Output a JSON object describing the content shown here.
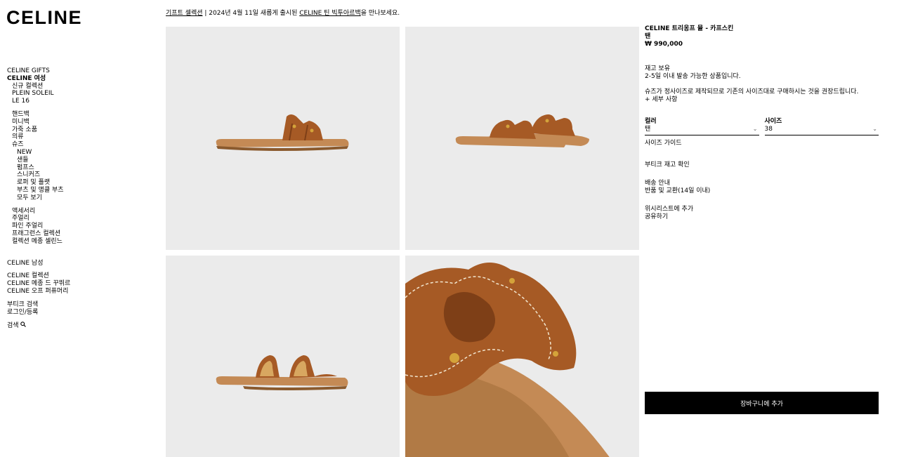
{
  "brand": "CELINE",
  "promo": {
    "link1": "기프트 셀렉션",
    "sep": " | 2024년 4월 11일 새롭게 출시된 ",
    "link2": "CELINE 틴 빅투아르백",
    "suffix": "을 만나보세요."
  },
  "nav": {
    "gifts": "CELINE GIFTS",
    "women": "CELINE 여성",
    "women_top": [
      "신규 컬렉션",
      "PLEIN SOLEIL",
      "LE 16"
    ],
    "women_cats": [
      "핸드백",
      "미니백",
      "가죽 소품",
      "의류",
      "슈즈"
    ],
    "shoes_sub": [
      "NEW",
      "샌들",
      "펌프스",
      "스니커즈",
      "로퍼 및 플랫",
      "부츠 및 앵클 부츠",
      "모두 보기"
    ],
    "women_more": [
      "액세서리",
      "주얼리",
      "파인 주얼리",
      "프래그런스 컬렉션",
      "컬렉션 메종 셀린느"
    ],
    "men": "CELINE 남성",
    "extra": [
      "CELINE 컬렉션",
      "CELINE 메종 드 꾸뛰르",
      "CELINE 오프 퍼퓨머리"
    ],
    "account": [
      "부티크 검색",
      "로그인/등록"
    ],
    "search": "검색"
  },
  "product": {
    "title": "CELINE 트리옹프 뮬 - 카프스킨",
    "color_name": "탠",
    "price": "₩ 990,000",
    "stock": "재고 보유",
    "shipping": "2-5일 이내 발송 가능한 상품입니다.",
    "size_note": "슈즈가 정사이즈로 제작되므로 기존의 사이즈대로 구매하시는 것을 권장드립니다.",
    "details": "+ 세부 사항",
    "color_label": "컬러",
    "color_value": "탠",
    "size_label": "사이즈",
    "size_value": "38",
    "size_guide": "사이즈 가이드",
    "boutique_stock": "부티크 재고 확인",
    "delivery": "배송 안내",
    "returns": "반품 및 교환(14일 이내)",
    "wishlist": "위시리스트에 추가",
    "share": "공유하기",
    "add_to_cart": "장바구니에 추가"
  },
  "colors": {
    "leather": "#a65a25",
    "leather_dark": "#7e3f17",
    "sole": "#c48a55",
    "tile_bg": "#ebebeb"
  }
}
